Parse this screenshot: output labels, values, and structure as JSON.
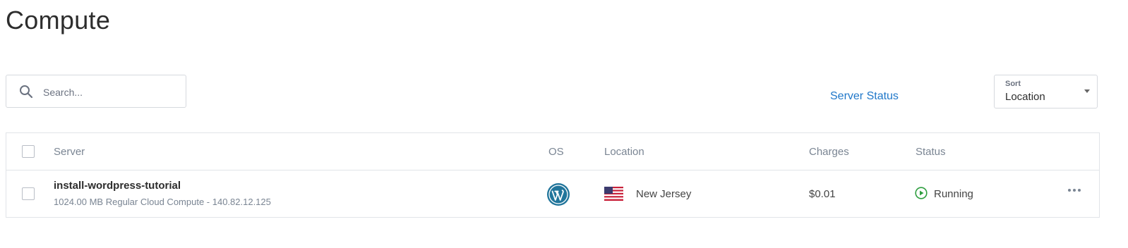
{
  "header": {
    "title": "Compute"
  },
  "search": {
    "placeholder": "Search...",
    "value": ""
  },
  "toolbar": {
    "server_status_link": "Server Status",
    "sort": {
      "label": "Sort",
      "value": "Location"
    }
  },
  "table": {
    "columns": [
      "Server",
      "OS",
      "Location",
      "Charges",
      "Status"
    ],
    "rows": [
      {
        "name": "install-wordpress-tutorial",
        "description": "1024.00 MB Regular Cloud Compute - 140.82.12.125",
        "os_icon": "wordpress-icon",
        "location_flag": "us-flag-icon",
        "location": "New Jersey",
        "charges": "$0.01",
        "status_icon": "play-circle-icon",
        "status": "Running"
      }
    ]
  },
  "colors": {
    "link": "#1f77c9",
    "status_running": "#2e9e3f",
    "wordpress": "#21759b",
    "border": "#e1e4e8",
    "muted_text": "#7a8593"
  },
  "icons": {
    "search": "search-icon",
    "sort_caret": "chevron-down-icon",
    "row_menu": "more-horizontal-icon"
  }
}
